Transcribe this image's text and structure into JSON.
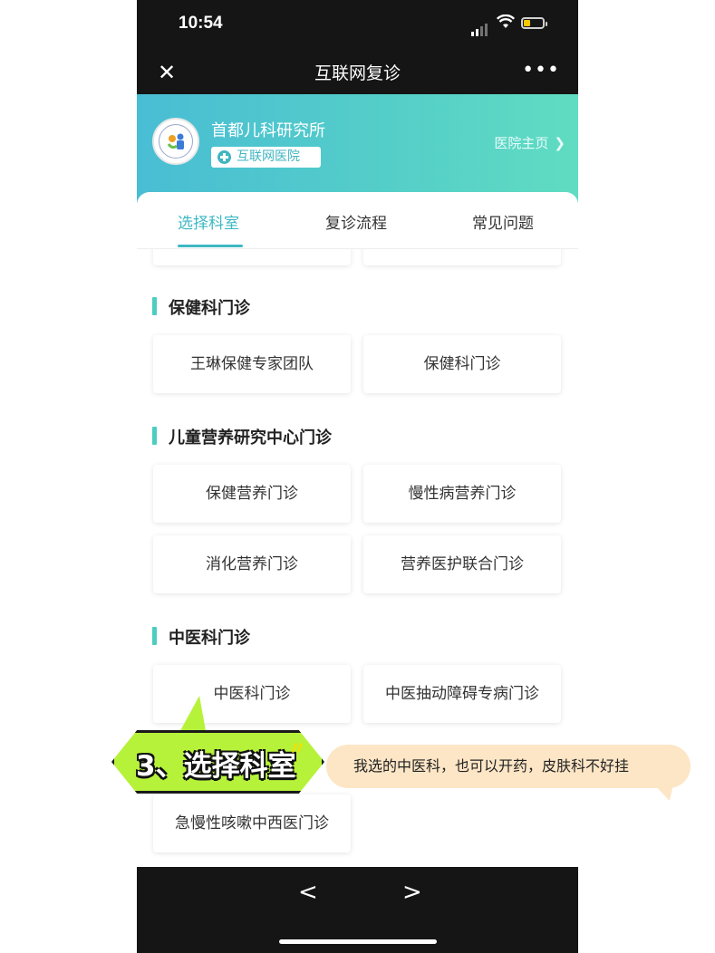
{
  "status_bar": {
    "time": "10:54"
  },
  "nav": {
    "title": "互联网复诊",
    "close_icon": "close-icon",
    "more_icon": "more-icon"
  },
  "hospital": {
    "name": "首都儿科研究所",
    "tag": "互联网医院",
    "home_link": "医院主页",
    "accent": "#3eb8c3"
  },
  "tabs": [
    {
      "label": "选择科室",
      "active": true
    },
    {
      "label": "复诊流程",
      "active": false
    },
    {
      "label": "常见问题",
      "active": false
    }
  ],
  "sections": [
    {
      "title": "保健科门诊",
      "items": [
        "王琳保健专家团队",
        "保健科门诊"
      ]
    },
    {
      "title": "儿童营养研究中心门诊",
      "items": [
        "保健营养门诊",
        "慢性病营养门诊",
        "消化营养门诊",
        "营养医护联合门诊"
      ]
    },
    {
      "title": "中医科门诊",
      "items": [
        "中医科门诊",
        "中医抽动障碍专病门诊",
        "急慢性咳嗽中西医门诊"
      ]
    }
  ],
  "overlay": {
    "sticker_text": "3、选择科室",
    "bubble_text": "我选的中医科，也可以开药，皮肤科不好挂"
  },
  "bottom_nav": {
    "back_icon": "chevron-left-icon",
    "forward_icon": "chevron-right-icon"
  }
}
